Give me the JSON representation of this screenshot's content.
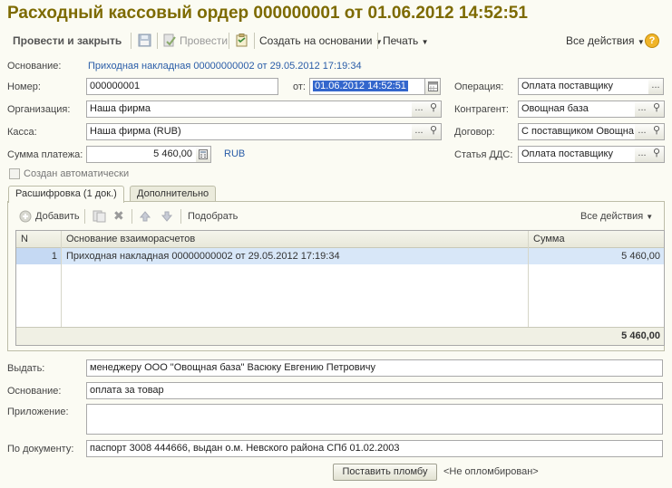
{
  "window": {
    "title": "Расходный кассовый ордер 000000001 от 01.06.2012 14:52:51"
  },
  "toolbar": {
    "post_and_close": "Провести и закрыть",
    "post": "Провести",
    "create_based_on": "Создать на основании",
    "print": "Печать",
    "all_actions": "Все действия",
    "help": "?"
  },
  "basis_top": {
    "label": "Основание:",
    "value": "Приходная накладная 00000000002 от 29.05.2012 17:19:34"
  },
  "fields": {
    "number": {
      "label": "Номер:",
      "value": "000000001"
    },
    "date": {
      "label": "от:",
      "value": "01.06.2012 14:52:51"
    },
    "organization": {
      "label": "Организация:",
      "value": "Наша фирма"
    },
    "cashbox": {
      "label": "Касса:",
      "value": "Наша фирма (RUB)"
    },
    "amount": {
      "label": "Сумма платежа:",
      "value": "5 460,00",
      "currency": "RUB"
    },
    "auto_created": {
      "label": "Создан автоматически",
      "checked": false
    },
    "operation": {
      "label": "Операция:",
      "value": "Оплата поставщику"
    },
    "counterparty": {
      "label": "Контрагент:",
      "value": "Овощная база"
    },
    "contract": {
      "label": "Договор:",
      "value": "С поставщиком Овощна"
    },
    "cashflow_item": {
      "label": "Статья ДДС:",
      "value": "Оплата поставщику"
    }
  },
  "tabs": [
    {
      "label": "Расшифровка (1 док.)",
      "active": true
    },
    {
      "label": "Дополнительно",
      "active": false
    }
  ],
  "table_toolbar": {
    "add": "Добавить",
    "pick": "Подобрать",
    "all_actions": "Все действия"
  },
  "table": {
    "columns": [
      "N",
      "Основание взаиморасчетов",
      "Сумма"
    ],
    "rows": [
      {
        "n": "1",
        "basis": "Приходная накладная 00000000002 от 29.05.2012 17:19:34",
        "sum": "5 460,00"
      }
    ],
    "total": "5 460,00"
  },
  "bottom": {
    "issue_to": {
      "label": "Выдать:",
      "value": "менеджеру ООО \"Овощная база\" Васюку Евгению Петровичу"
    },
    "basis": {
      "label": "Основание:",
      "value": "оплата за товар"
    },
    "attachment": {
      "label": "Приложение:",
      "value": ""
    },
    "by_document": {
      "label": "По документу:",
      "value": "паспорт 3008 444666, выдан о.м. Невского района СПб 01.02.2003"
    }
  },
  "seal": {
    "button": "Поставить пломбу",
    "status": "<Не опломбирован>"
  },
  "colors": {
    "title": "#7D6A00",
    "link": "#2A5DA8",
    "selection": "#3366CC",
    "row_selected": "#D8E7F8"
  }
}
